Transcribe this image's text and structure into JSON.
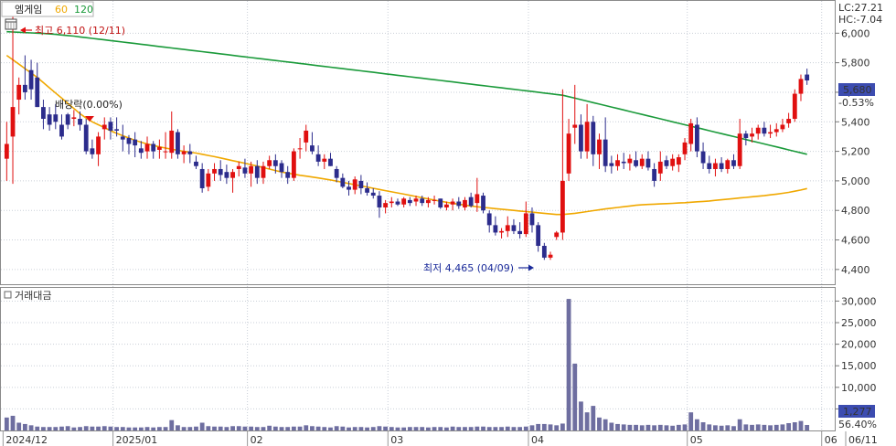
{
  "legend": {
    "name": "엠게임",
    "ma60_label": "60",
    "ma120_label": "120",
    "ma60_color": "#f0a800",
    "ma120_color": "#1a9a3a"
  },
  "corner": {
    "lc": "LC:27.21",
    "hc": "HC:-7.04",
    "color": "#e00000",
    "hc_color": "#2030c0"
  },
  "volume_panel_label": "거래대금",
  "current": {
    "price": "5,680",
    "change": "-0.53%",
    "volume": "1,277",
    "volume_ratio": "56.40%"
  },
  "annotations": {
    "high": "최고 6,110 (12/11)",
    "low": "최저 4,465 (04/09)",
    "dividend": "배당락(0.00%)"
  },
  "colors": {
    "up": "#e01010",
    "down": "#2c2c8c",
    "volume": "#6e6ea0",
    "highlight_bg": "#3c4cb0",
    "grid": "#c9cfd8"
  },
  "chart_data": {
    "type": "candlestick",
    "price_axis": {
      "ylim": [
        4300,
        6200
      ],
      "ticks": [
        "6,000",
        "5,800",
        "5,600",
        "5,400",
        "5,200",
        "5,000",
        "4,800",
        "4,600",
        "4,400"
      ],
      "tick_values": [
        6000,
        5800,
        5600,
        5400,
        5200,
        5000,
        4800,
        4600,
        4400
      ]
    },
    "volume_axis": {
      "ylim": [
        0,
        32000
      ],
      "ticks": [
        "30,000",
        "25,000",
        "20,000",
        "15,000",
        "10,000",
        "5,000"
      ],
      "tick_values": [
        30000,
        25000,
        20000,
        15000,
        10000,
        5000
      ]
    },
    "date_labels": [
      {
        "text": "2024/12",
        "index": 0
      },
      {
        "text": "2025/01",
        "index": 18
      },
      {
        "text": "02",
        "index": 40
      },
      {
        "text": "03",
        "index": 63
      },
      {
        "text": "04",
        "index": 86
      },
      {
        "text": "05",
        "index": 112
      },
      {
        "text": "06",
        "index": 134
      },
      {
        "text": "06/11",
        "index": 146
      }
    ],
    "candles": [
      [
        5150,
        5400,
        5000,
        5250,
        3000
      ],
      [
        5300,
        6110,
        4980,
        5500,
        3400
      ],
      [
        5550,
        5700,
        5450,
        5650,
        1800
      ],
      [
        5650,
        5850,
        5550,
        5600,
        1500
      ],
      [
        5750,
        5820,
        5550,
        5620,
        1200
      ],
      [
        5700,
        5800,
        5500,
        5500,
        900
      ],
      [
        5500,
        5550,
        5350,
        5420,
        800
      ],
      [
        5450,
        5500,
        5340,
        5380,
        800
      ],
      [
        5450,
        5520,
        5350,
        5400,
        800
      ],
      [
        5380,
        5450,
        5280,
        5300,
        900
      ],
      [
        5450,
        5460,
        5350,
        5380,
        1000
      ],
      [
        5420,
        5480,
        5370,
        5430,
        700
      ],
      [
        5420,
        5470,
        5340,
        5380,
        800
      ],
      [
        5380,
        5420,
        5180,
        5200,
        1000
      ],
      [
        5220,
        5280,
        5150,
        5180,
        900
      ],
      [
        5180,
        5330,
        5100,
        5300,
        900
      ],
      [
        5350,
        5430,
        5280,
        5380,
        1000
      ],
      [
        5400,
        5430,
        5280,
        5340,
        900
      ],
      [
        5350,
        5430,
        5300,
        5340,
        800
      ],
      [
        5300,
        5380,
        5200,
        5280,
        800
      ],
      [
        5290,
        5310,
        5180,
        5250,
        700
      ],
      [
        5280,
        5330,
        5160,
        5240,
        700
      ],
      [
        5220,
        5270,
        5150,
        5190,
        700
      ],
      [
        5200,
        5300,
        5150,
        5250,
        800
      ],
      [
        5250,
        5270,
        5150,
        5200,
        700
      ],
      [
        5210,
        5280,
        5150,
        5230,
        800
      ],
      [
        5200,
        5330,
        5150,
        5200,
        800
      ],
      [
        5190,
        5470,
        5150,
        5340,
        2400
      ],
      [
        5330,
        5350,
        5150,
        5180,
        1200
      ],
      [
        5180,
        5240,
        5120,
        5200,
        800
      ],
      [
        5200,
        5250,
        5120,
        5180,
        800
      ],
      [
        5130,
        5170,
        5080,
        5100,
        900
      ],
      [
        5080,
        5120,
        4920,
        4950,
        1800
      ],
      [
        4960,
        5080,
        4930,
        5050,
        1000
      ],
      [
        5050,
        5120,
        5000,
        5080,
        900
      ],
      [
        5080,
        5140,
        5000,
        5040,
        900
      ],
      [
        5060,
        5110,
        4980,
        5020,
        800
      ],
      [
        5020,
        5080,
        4920,
        5060,
        1000
      ],
      [
        5080,
        5130,
        5030,
        5100,
        1000
      ],
      [
        5090,
        5150,
        5020,
        5050,
        900
      ],
      [
        5050,
        5130,
        4960,
        5100,
        900
      ],
      [
        5100,
        5140,
        4980,
        5020,
        800
      ],
      [
        5020,
        5130,
        4980,
        5100,
        800
      ],
      [
        5100,
        5170,
        5080,
        5140,
        1100
      ],
      [
        5140,
        5180,
        5050,
        5100,
        900
      ],
      [
        5120,
        5140,
        5020,
        5060,
        800
      ],
      [
        5060,
        5100,
        4980,
        5020,
        800
      ],
      [
        5020,
        5220,
        5000,
        5200,
        900
      ],
      [
        5220,
        5290,
        5150,
        5220,
        900
      ],
      [
        5260,
        5380,
        5200,
        5340,
        1200
      ],
      [
        5240,
        5330,
        5180,
        5200,
        1000
      ],
      [
        5180,
        5240,
        5100,
        5130,
        900
      ],
      [
        5130,
        5180,
        5080,
        5150,
        800
      ],
      [
        5150,
        5190,
        5100,
        5100,
        700
      ],
      [
        5080,
        5100,
        4990,
        5020,
        1000
      ],
      [
        5020,
        5050,
        4950,
        4960,
        900
      ],
      [
        4960,
        5000,
        4900,
        4940,
        700
      ],
      [
        4940,
        5030,
        4910,
        5010,
        800
      ],
      [
        5000,
        5040,
        4910,
        4950,
        800
      ],
      [
        4950,
        4990,
        4900,
        4920,
        700
      ],
      [
        4920,
        4950,
        4880,
        4900,
        800
      ],
      [
        4900,
        4930,
        4750,
        4820,
        1000
      ],
      [
        4820,
        4870,
        4780,
        4850,
        900
      ],
      [
        4850,
        4890,
        4820,
        4860,
        800
      ],
      [
        4860,
        4880,
        4830,
        4840,
        700
      ],
      [
        4840,
        4890,
        4820,
        4880,
        700
      ],
      [
        4870,
        4890,
        4830,
        4850,
        800
      ],
      [
        4860,
        4900,
        4830,
        4880,
        800
      ],
      [
        4880,
        4900,
        4830,
        4850,
        800
      ],
      [
        4850,
        4890,
        4820,
        4870,
        700
      ],
      [
        4870,
        4900,
        4840,
        4870,
        800
      ],
      [
        4880,
        4880,
        4810,
        4820,
        800
      ],
      [
        4820,
        4860,
        4800,
        4840,
        700
      ],
      [
        4840,
        4880,
        4800,
        4860,
        900
      ],
      [
        4860,
        4890,
        4810,
        4830,
        800
      ],
      [
        4820,
        4890,
        4800,
        4870,
        800
      ],
      [
        4890,
        4920,
        4820,
        4830,
        800
      ],
      [
        4850,
        5020,
        4790,
        4910,
        900
      ],
      [
        4900,
        4920,
        4780,
        4800,
        900
      ],
      [
        4780,
        4800,
        4650,
        4700,
        800
      ],
      [
        4700,
        4760,
        4630,
        4650,
        800
      ],
      [
        4650,
        4680,
        4610,
        4660,
        800
      ],
      [
        4660,
        4760,
        4620,
        4700,
        900
      ],
      [
        4700,
        4740,
        4640,
        4660,
        800
      ],
      [
        4660,
        4720,
        4610,
        4640,
        800
      ],
      [
        4640,
        4860,
        4620,
        4780,
        900
      ],
      [
        4780,
        4820,
        4650,
        4700,
        1200
      ],
      [
        4700,
        4720,
        4520,
        4560,
        1500
      ],
      [
        4560,
        4580,
        4465,
        4480,
        1500
      ],
      [
        4480,
        4520,
        4465,
        4500,
        1400
      ],
      [
        4620,
        4660,
        4600,
        4650,
        1200
      ],
      [
        4650,
        5620,
        4600,
        5000,
        1600
      ],
      [
        5050,
        5420,
        5000,
        5320,
        30500
      ],
      [
        5360,
        5650,
        5250,
        5380,
        15500
      ],
      [
        5380,
        5450,
        5150,
        5200,
        6700
      ],
      [
        5200,
        5520,
        5150,
        5400,
        4200
      ],
      [
        5400,
        5440,
        5100,
        5180,
        5700
      ],
      [
        5180,
        5320,
        5080,
        5280,
        3000
      ],
      [
        5280,
        5430,
        5060,
        5100,
        2600
      ],
      [
        5120,
        5170,
        5050,
        5100,
        1800
      ],
      [
        5100,
        5180,
        5070,
        5140,
        1500
      ],
      [
        5130,
        5190,
        5080,
        5120,
        1400
      ],
      [
        5120,
        5180,
        5070,
        5150,
        1300
      ],
      [
        5140,
        5200,
        5090,
        5100,
        1300
      ],
      [
        5100,
        5180,
        5080,
        5150,
        1200
      ],
      [
        5150,
        5200,
        5070,
        5090,
        1300
      ],
      [
        5080,
        5120,
        4960,
        5000,
        1200
      ],
      [
        5050,
        5200,
        5000,
        5130,
        1300
      ],
      [
        5140,
        5170,
        5080,
        5100,
        1200
      ],
      [
        5100,
        5180,
        5070,
        5150,
        1100
      ],
      [
        5110,
        5180,
        5060,
        5160,
        1300
      ],
      [
        5180,
        5290,
        5140,
        5260,
        1400
      ],
      [
        5250,
        5420,
        5200,
        5390,
        4200
      ],
      [
        5380,
        5430,
        5160,
        5200,
        2600
      ],
      [
        5200,
        5260,
        5080,
        5120,
        1900
      ],
      [
        5120,
        5170,
        5050,
        5080,
        1400
      ],
      [
        5080,
        5150,
        5030,
        5120,
        1200
      ],
      [
        5120,
        5160,
        5060,
        5080,
        1100
      ],
      [
        5080,
        5150,
        5050,
        5140,
        1200
      ],
      [
        5140,
        5180,
        5080,
        5100,
        1000
      ],
      [
        5100,
        5420,
        5080,
        5320,
        2600
      ],
      [
        5320,
        5340,
        5240,
        5290,
        1400
      ],
      [
        5300,
        5360,
        5260,
        5320,
        1300
      ],
      [
        5320,
        5380,
        5280,
        5360,
        1400
      ],
      [
        5360,
        5400,
        5300,
        5320,
        1300
      ],
      [
        5320,
        5380,
        5290,
        5330,
        1200
      ],
      [
        5330,
        5390,
        5300,
        5350,
        1300
      ],
      [
        5350,
        5420,
        5330,
        5380,
        1400
      ],
      [
        5390,
        5460,
        5360,
        5420,
        1700
      ],
      [
        5420,
        5620,
        5400,
        5590,
        1900
      ],
      [
        5590,
        5720,
        5540,
        5690,
        2200
      ],
      [
        5720,
        5760,
        5650,
        5680,
        1277
      ]
    ],
    "ma60": [
      5850,
      5820,
      5790,
      5760,
      5730,
      5700,
      5665,
      5630,
      5595,
      5560,
      5525,
      5490,
      5455,
      5425,
      5400,
      5380,
      5360,
      5340,
      5322,
      5306,
      5290,
      5275,
      5262,
      5250,
      5240,
      5230,
      5222,
      5214,
      5207,
      5200,
      5194,
      5188,
      5180,
      5172,
      5164,
      5155,
      5146,
      5137,
      5128,
      5119,
      5110,
      5100,
      5090,
      5080,
      5070,
      5060,
      5052,
      5045,
      5038,
      5032,
      5026,
      5020,
      5013,
      5006,
      4998,
      4990,
      4982,
      4974,
      4966,
      4958,
      4950,
      4942,
      4934,
      4926,
      4918,
      4910,
      4902,
      4894,
      4886,
      4878,
      4870,
      4862,
      4855,
      4848,
      4842,
      4836,
      4830,
      4825,
      4820,
      4816,
      4812,
      4808,
      4804,
      4800,
      4796,
      4792,
      4788,
      4784,
      4780,
      4776,
      4772,
      4772,
      4776,
      4780,
      4786,
      4792,
      4798,
      4804,
      4810,
      4815,
      4820,
      4825,
      4830,
      4835,
      4838,
      4840,
      4842,
      4844,
      4846,
      4848,
      4850,
      4852,
      4855,
      4858,
      4861,
      4864,
      4868,
      4872,
      4876,
      4880,
      4884,
      4888,
      4892,
      4896,
      4900,
      4905,
      4910,
      4916,
      4922,
      4930,
      4938,
      4948,
      4958,
      4970,
      4984,
      5000,
      5018,
      5038,
      5058,
      5078,
      5095,
      5108,
      5120,
      5130,
      5140,
      5150,
      5160,
      5170
    ],
    "ma120": [
      6010,
      6008,
      6006,
      6004,
      6002,
      6000,
      5998,
      5995,
      5992,
      5988,
      5984,
      5980,
      5975,
      5970,
      5965,
      5960,
      5955,
      5950,
      5945,
      5940,
      5935,
      5930,
      5925,
      5920,
      5915,
      5910,
      5905,
      5900,
      5895,
      5890,
      5885,
      5880,
      5875,
      5870,
      5865,
      5860,
      5855,
      5850,
      5845,
      5840,
      5835,
      5830,
      5825,
      5820,
      5815,
      5810,
      5805,
      5800,
      5795,
      5790,
      5785,
      5780,
      5775,
      5770,
      5765,
      5760,
      5755,
      5750,
      5745,
      5740,
      5735,
      5730,
      5725,
      5720,
      5715,
      5710,
      5705,
      5700,
      5695,
      5690,
      5685,
      5680,
      5675,
      5670,
      5665,
      5660,
      5655,
      5650,
      5645,
      5640,
      5635,
      5630,
      5625,
      5620,
      5615,
      5610,
      5605,
      5600,
      5595,
      5590,
      5585,
      5580,
      5570,
      5560,
      5550,
      5540,
      5530,
      5520,
      5510,
      5500,
      5490,
      5480,
      5470,
      5460,
      5450,
      5440,
      5430,
      5420,
      5410,
      5400,
      5390,
      5380,
      5370,
      5360,
      5350,
      5340,
      5330,
      5320,
      5310,
      5300,
      5290,
      5280,
      5270,
      5260,
      5250,
      5240,
      5230,
      5220,
      5210,
      5200,
      5190,
      5180,
      5170,
      5160,
      5150,
      5140,
      5135,
      5130,
      5128,
      5126,
      5124,
      5122,
      5120,
      5120,
      5120,
      5120,
      5120,
      5120,
      5120,
      5120
    ]
  }
}
